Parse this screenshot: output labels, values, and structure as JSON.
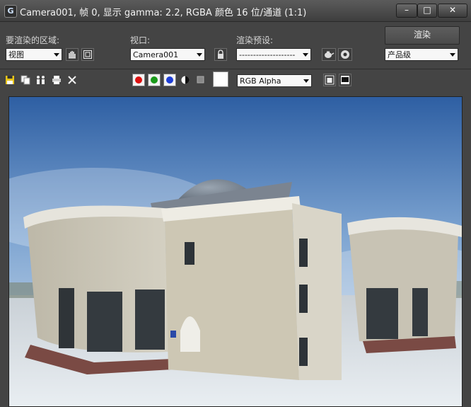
{
  "window": {
    "title": "Camera001, 帧 0, 显示 gamma: 2.2, RGBA 颜色 16 位/通道 (1:1)",
    "app_icon_glyph": "G",
    "controls": {
      "minimize": "–",
      "maximize": "□",
      "close": "✕"
    }
  },
  "area": {
    "label": "要渲染的区域:",
    "value": "视图"
  },
  "viewport": {
    "label": "视口:",
    "value": "Camera001"
  },
  "preset": {
    "label": "渲染预设:",
    "value": "--------------------"
  },
  "render": {
    "button_label": "渲染",
    "quality_value": "产品级"
  },
  "channels": {
    "red_color": "#d11",
    "green_color": "#1a9a1a",
    "blue_color": "#1f3fd6",
    "alpha_value": "RGB Alpha",
    "swatch_color": "#ffffff"
  },
  "icons": [
    "save-icon",
    "copy-icon",
    "clone-icon",
    "print-icon",
    "clear-icon",
    "region-icon",
    "crop-icon",
    "lock-icon",
    "teapot-render-icon",
    "environment-icon",
    "monochrome-icon",
    "display-channel-icon",
    "image-window-icon",
    "frame-buffer-icon"
  ]
}
